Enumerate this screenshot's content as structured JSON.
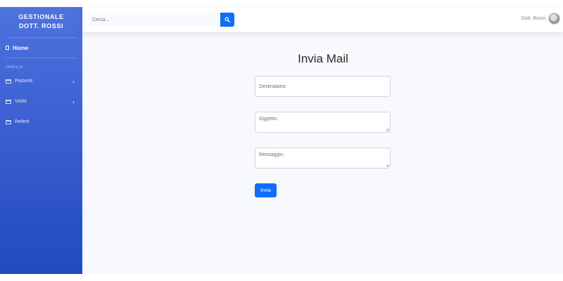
{
  "sidebar": {
    "brand_line1": "GESTIONALE",
    "brand_line2": "DOTT. ROSSI",
    "home_label": "Home",
    "section_heading": "TABELLE",
    "items": [
      {
        "label": "Pazienti",
        "has_submenu": true
      },
      {
        "label": "Visite",
        "has_submenu": true
      },
      {
        "label": "Referti",
        "has_submenu": false
      }
    ]
  },
  "topbar": {
    "search_placeholder": "Cerca...",
    "user_name": "Dott. Rossi"
  },
  "form": {
    "title": "Invia Mail",
    "recipient_placeholder": "Destinatario:",
    "subject_placeholder": "Oggetto:",
    "message_placeholder": "Messaggio:",
    "submit_label": "Invia"
  },
  "colors": {
    "sidebar_top": "#4e73df",
    "sidebar_bottom": "#224abe",
    "primary": "#0d6efd",
    "page_bg": "#f8f9fc"
  }
}
